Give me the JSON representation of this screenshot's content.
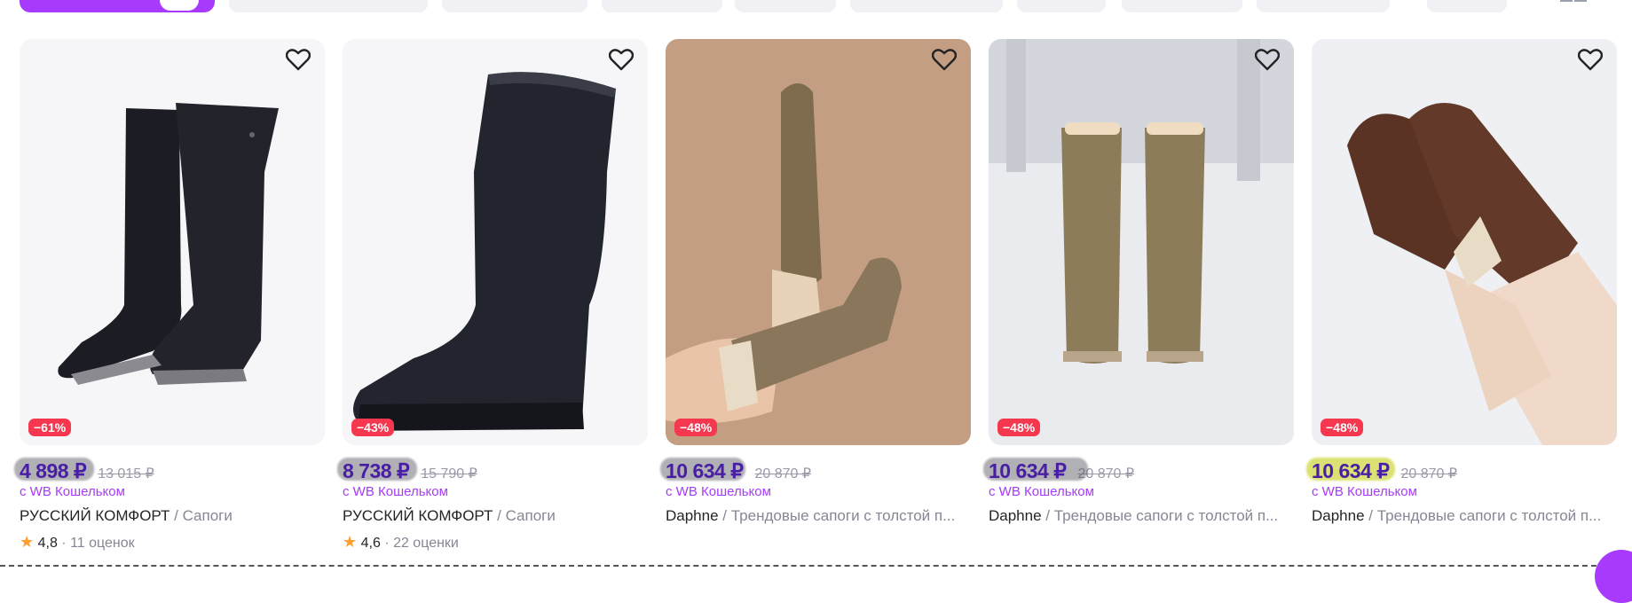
{
  "products": [
    {
      "discount": "−61%",
      "price": "4 898 ₽",
      "old_price": "13 015 ₽",
      "wallet": "с WB Кошельком",
      "brand": "РУССКИЙ КОМФОРТ",
      "category": " / Сапоги",
      "rating": "4,8",
      "reviews": " · 11 оценок"
    },
    {
      "discount": "−43%",
      "price": "8 738 ₽",
      "old_price": "15 790 ₽",
      "wallet": "с WB Кошельком",
      "brand": "РУССКИЙ КОМФОРТ",
      "category": " / Сапоги",
      "rating": "4,6",
      "reviews": " · 22 оценки"
    },
    {
      "discount": "−48%",
      "price": "10 634 ₽",
      "old_price": "20 870 ₽",
      "wallet": "с WB Кошельком",
      "brand": "Daphne",
      "category": " / Трендовые сапоги с толстой п...",
      "rating": "",
      "reviews": ""
    },
    {
      "discount": "−48%",
      "price": "10 634 ₽",
      "old_price": "20 870 ₽",
      "wallet": "с WB Кошельком",
      "brand": "Daphne",
      "category": " / Трендовые сапоги с толстой п...",
      "rating": "",
      "reviews": ""
    },
    {
      "discount": "−48%",
      "price": "10 634 ₽",
      "old_price": "20 870 ₽",
      "wallet": "с WB Кошельком",
      "brand": "Daphne",
      "category": " / Трендовые сапоги с толстой п...",
      "rating": "",
      "reviews": ""
    }
  ],
  "colors": {
    "price": "#481ea4",
    "accent": "#a73afd",
    "discount_badge": "#f5384f",
    "star": "#ff9e2d"
  },
  "icons": {
    "favorite": "heart-outline-icon",
    "rating": "star-icon"
  }
}
